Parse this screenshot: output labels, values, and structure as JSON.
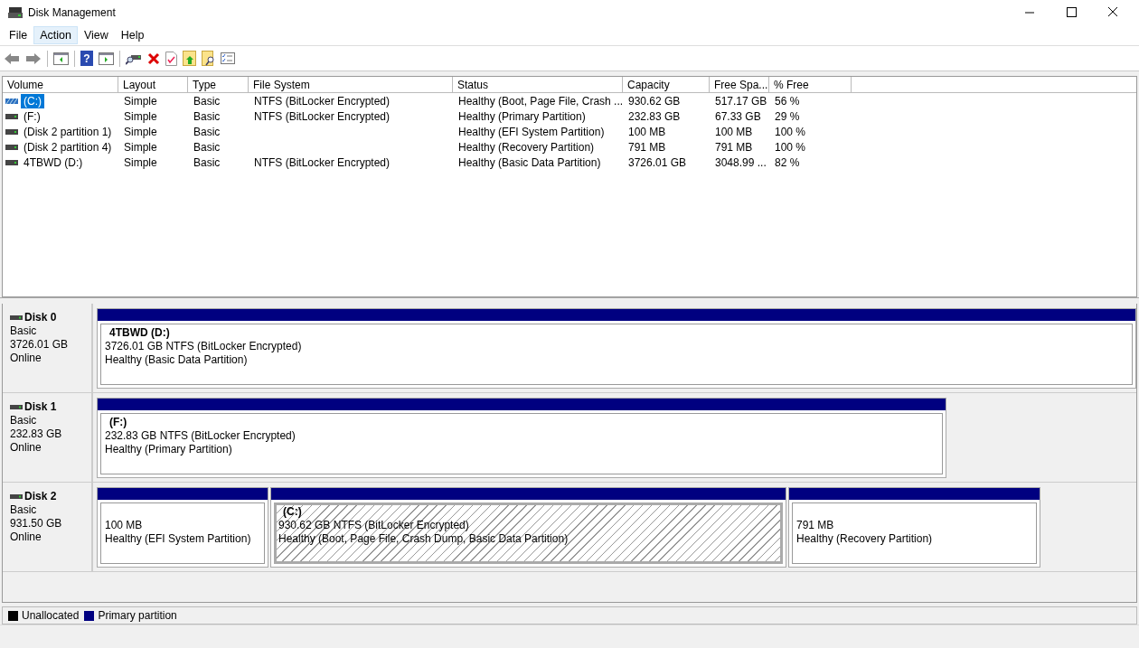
{
  "window": {
    "title": "Disk Management"
  },
  "menu": [
    {
      "label": "File",
      "selected": false
    },
    {
      "label": "Action",
      "selected": true
    },
    {
      "label": "View",
      "selected": false
    },
    {
      "label": "Help",
      "selected": false
    }
  ],
  "toolbar": {
    "help_glyph": "?"
  },
  "table": {
    "columns": [
      "Volume",
      "Layout",
      "Type",
      "File System",
      "Status",
      "Capacity",
      "Free Spa...",
      "% Free"
    ],
    "rows": [
      {
        "kind": "striped",
        "selected": true,
        "cells": [
          "(C:)",
          "Simple",
          "Basic",
          "NTFS (BitLocker Encrypted)",
          "Healthy (Boot, Page File, Crash ...",
          "930.62 GB",
          "517.17 GB",
          "56 %"
        ]
      },
      {
        "kind": "drive",
        "selected": false,
        "cells": [
          "(F:)",
          "Simple",
          "Basic",
          "NTFS (BitLocker Encrypted)",
          "Healthy (Primary Partition)",
          "232.83 GB",
          "67.33 GB",
          "29 %"
        ]
      },
      {
        "kind": "drive",
        "selected": false,
        "cells": [
          "(Disk 2 partition 1)",
          "Simple",
          "Basic",
          "",
          "Healthy (EFI System Partition)",
          "100 MB",
          "100 MB",
          "100 %"
        ]
      },
      {
        "kind": "drive",
        "selected": false,
        "cells": [
          "(Disk 2 partition 4)",
          "Simple",
          "Basic",
          "",
          "Healthy (Recovery Partition)",
          "791 MB",
          "791 MB",
          "100 %"
        ]
      },
      {
        "kind": "drive",
        "selected": false,
        "cells": [
          "4TBWD (D:)",
          "Simple",
          "Basic",
          "NTFS (BitLocker Encrypted)",
          "Healthy (Basic Data Partition)",
          "3726.01 GB",
          "3048.99 ...",
          "82 %"
        ]
      }
    ]
  },
  "disks": [
    {
      "name": "Disk 0",
      "type": "Basic",
      "size": "3726.01 GB",
      "state": "Online",
      "partitions": [
        {
          "title": "4TBWD  (D:)",
          "size": "3726.01 GB NTFS (BitLocker Encrypted)",
          "status": "Healthy (Basic Data Partition)",
          "selected": false
        }
      ]
    },
    {
      "name": "Disk 1",
      "type": "Basic",
      "size": "232.83 GB",
      "state": "Online",
      "partitions": [
        {
          "title": "(F:)",
          "size": "232.83 GB NTFS (BitLocker Encrypted)",
          "status": "Healthy (Primary Partition)",
          "selected": false
        }
      ]
    },
    {
      "name": "Disk 2",
      "type": "Basic",
      "size": "931.50 GB",
      "state": "Online",
      "partitions": [
        {
          "size": "100 MB",
          "status": "Healthy (EFI System Partition)",
          "selected": false
        },
        {
          "title": "(C:)",
          "size": "930.62 GB NTFS (BitLocker Encrypted)",
          "status": "Healthy (Boot, Page File, Crash Dump, Basic Data Partition)",
          "selected": true
        },
        {
          "size": "791 MB",
          "status": "Healthy (Recovery Partition)",
          "selected": false
        }
      ]
    }
  ],
  "legend": [
    {
      "label": "Unallocated",
      "color": "#000000"
    },
    {
      "label": "Primary partition",
      "color": "#000080"
    }
  ]
}
